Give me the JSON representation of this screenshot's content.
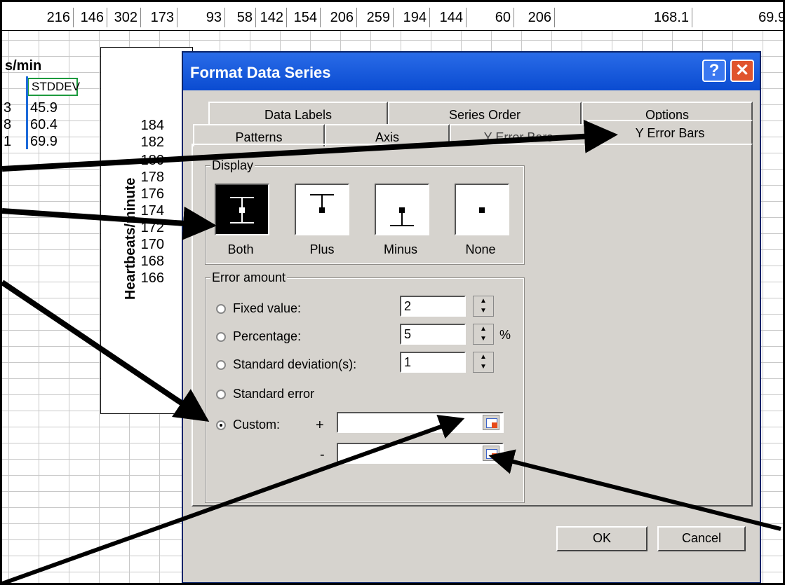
{
  "sheet": {
    "top_row": [
      "216",
      "146",
      "302",
      "173",
      "93",
      "58",
      "142",
      "154",
      "206",
      "259",
      "194",
      "144",
      "60",
      "206",
      "168.1",
      "69.9"
    ],
    "header_partial": "s/min",
    "stddev_header": "STDDEV",
    "rows": [
      {
        "left": "3",
        "value": "45.9"
      },
      {
        "left": "8",
        "value": "60.4"
      },
      {
        "left": "1",
        "value": "69.9"
      }
    ]
  },
  "chart": {
    "ylabel": "Heartbeats/minute",
    "yticks": [
      "184",
      "182",
      "180",
      "178",
      "176",
      "174",
      "172",
      "170",
      "168",
      "166"
    ]
  },
  "dialog": {
    "title": "Format Data Series",
    "help_label": "?",
    "close_label": "✕",
    "tabs_back": [
      "Data Labels",
      "Series Order",
      "Options"
    ],
    "tabs_front": [
      "Patterns",
      "Axis",
      "Y Error Bars",
      "Y Error Bars"
    ],
    "display": {
      "title": "Display",
      "options": [
        "Both",
        "Plus",
        "Minus",
        "None"
      ]
    },
    "error_amount": {
      "title": "Error amount",
      "fixed_label": "Fixed value:",
      "fixed_value": "2",
      "percentage_label": "Percentage:",
      "percentage_value": "5",
      "percent_sign": "%",
      "stddev_label": "Standard deviation(s):",
      "stddev_value": "1",
      "stderr_label": "Standard error",
      "custom_label": "Custom:",
      "plus_sign": "+",
      "minus_sign": "-",
      "custom_plus": "",
      "custom_minus": ""
    },
    "ok_label": "OK",
    "cancel_label": "Cancel"
  }
}
